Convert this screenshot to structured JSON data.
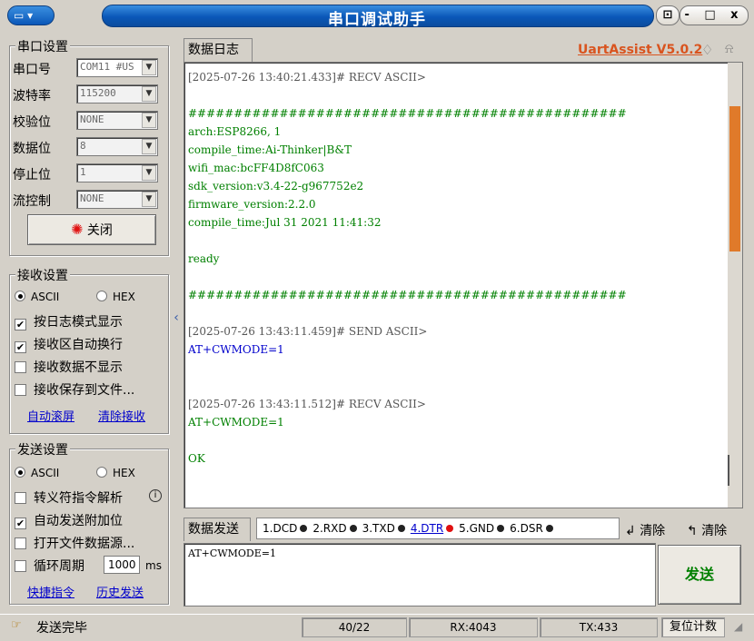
{
  "window": {
    "title": "串口调试助手",
    "app_icon": "monitor-icon",
    "pin_label": "屬",
    "controls": "- □ x"
  },
  "serial": {
    "group_title": "串口设置",
    "rows": [
      {
        "label": "串口号",
        "value": "COM11 #US"
      },
      {
        "label": "波特率",
        "value": "115200"
      },
      {
        "label": "校验位",
        "value": "NONE"
      },
      {
        "label": "数据位",
        "value": "8"
      },
      {
        "label": "停止位",
        "value": "1"
      },
      {
        "label": "流控制",
        "value": "NONE"
      }
    ],
    "close_label": "关闭"
  },
  "receive": {
    "group_title": "接收设置",
    "ascii": "ASCII",
    "hex": "HEX",
    "opts": [
      {
        "label": "按日志模式显示",
        "checked": true
      },
      {
        "label": "接收区自动换行",
        "checked": true
      },
      {
        "label": "接收数据不显示",
        "checked": false
      },
      {
        "label": "接收保存到文件...",
        "checked": false
      }
    ],
    "auto_scroll": "自动滚屏",
    "clear_recv": "清除接收"
  },
  "send": {
    "group_title": "发送设置",
    "ascii": "ASCII",
    "hex": "HEX",
    "opts": [
      {
        "label": "转义符指令解析",
        "checked": false
      },
      {
        "label": "自动发送附加位",
        "checked": true
      },
      {
        "label": "打开文件数据源...",
        "checked": false
      },
      {
        "label": "循环周期",
        "checked": false
      }
    ],
    "period_value": "1000",
    "period_unit": "ms",
    "shortcut": "快捷指令",
    "history": "历史发送"
  },
  "log": {
    "tab": "数据日志",
    "brand": "UartAssist V5.0.2",
    "lines": [
      {
        "t": "[2025-07-26 13:40:21.433]# RECV ASCII>",
        "c": "hdr"
      },
      {
        "t": "",
        "c": "recv"
      },
      {
        "t": "################################################",
        "c": "recv"
      },
      {
        "t": "arch:ESP8266, 1",
        "c": "recv"
      },
      {
        "t": "compile_time:Ai-Thinker|B&T",
        "c": "recv"
      },
      {
        "t": "wifi_mac:bcFF4D8fC063",
        "c": "recv"
      },
      {
        "t": "sdk_version:v3.4-22-g967752e2",
        "c": "recv"
      },
      {
        "t": "firmware_version:2.2.0",
        "c": "recv"
      },
      {
        "t": "compile_time:Jul 31 2021 11:41:32",
        "c": "recv"
      },
      {
        "t": "",
        "c": "recv"
      },
      {
        "t": "ready",
        "c": "recv"
      },
      {
        "t": "",
        "c": "recv"
      },
      {
        "t": "################################################",
        "c": "recv"
      },
      {
        "t": "",
        "c": "recv"
      },
      {
        "t": "[2025-07-26 13:43:11.459]# SEND ASCII>",
        "c": "hdr"
      },
      {
        "t": "AT+CWMODE=1",
        "c": "send"
      },
      {
        "t": "",
        "c": "recv"
      },
      {
        "t": "",
        "c": "recv"
      },
      {
        "t": "[2025-07-26 13:43:11.512]# RECV ASCII>",
        "c": "hdr"
      },
      {
        "t": "AT+CWMODE=1",
        "c": "recv"
      },
      {
        "t": "",
        "c": "recv"
      },
      {
        "t": "OK",
        "c": "recv"
      }
    ]
  },
  "sendarea": {
    "tab": "数据发送",
    "signals": [
      {
        "label": "1.DCD",
        "active": false
      },
      {
        "label": "2.RXD",
        "active": false
      },
      {
        "label": "3.TXD",
        "active": false
      },
      {
        "label": "4.DTR",
        "active": true
      },
      {
        "label": "5.GND",
        "active": false
      },
      {
        "label": "6.DSR",
        "active": false
      }
    ],
    "clear1": "清除",
    "clear2": "清除",
    "input": "AT+CWMODE=1",
    "send_button": "发送"
  },
  "status": {
    "message": "发送完毕",
    "count": "40/22",
    "rx": "RX:4043",
    "tx": "TX:433",
    "reset": "复位计数"
  },
  "colors": {
    "accent": "#0a57b8",
    "recv": "#008000",
    "send": "#0000cc",
    "brand": "#d9541f"
  }
}
